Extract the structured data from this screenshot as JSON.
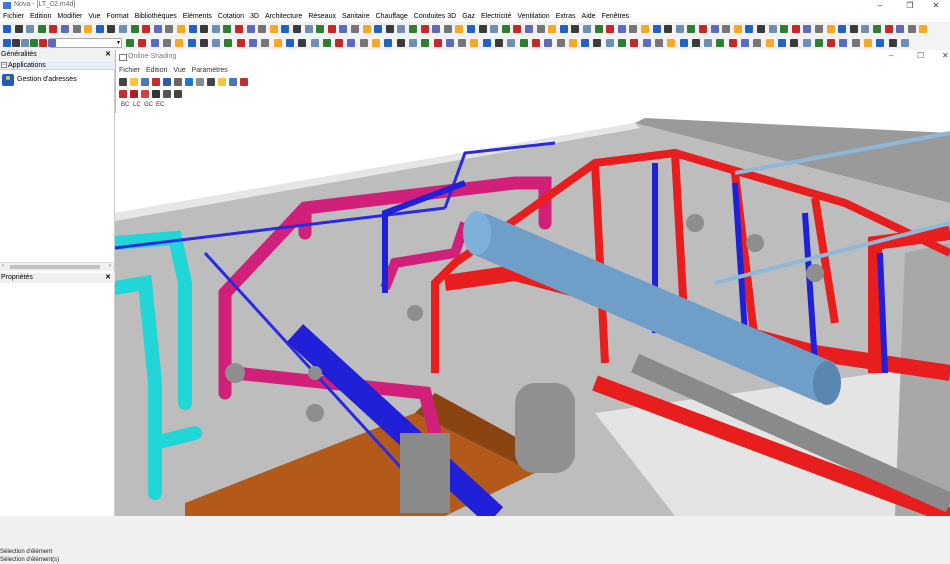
{
  "window": {
    "title": "Nova - [LT_02.m4d]"
  },
  "menu": [
    "Fichier",
    "Edition",
    "Modifier",
    "Vue",
    "Format",
    "Bibliothèques",
    "Eléments",
    "Cotation",
    "3D",
    "Architecture",
    "Réseaux",
    "Sanitaire",
    "Chauffage",
    "Conduites 3D",
    "Gaz",
    "Electricité",
    "Ventilation",
    "Extras",
    "Aide",
    "Fenêtres"
  ],
  "left_panel": {
    "header": "Généralités",
    "applications_label": "Applications",
    "app_item": "Gestion d'adresses",
    "properties_header": "Propriétés",
    "status_lines": [
      "Sélection d'élément",
      "Sélection d'élément(s)"
    ]
  },
  "child_window": {
    "title": "Online-Shading",
    "menu": [
      "Fichier",
      "Edition",
      "Vue",
      "Paramètres"
    ],
    "lod_buttons": [
      "BC",
      "LC",
      "GC",
      "EC"
    ]
  },
  "icons": {
    "close": "close-icon",
    "minimize": "minimize-icon",
    "restore": "restore-icon",
    "colors": {
      "hot_pipe": "#e81e1e",
      "cold_pipe": "#2a2ae0",
      "magenta_pipe": "#d0207a",
      "cyan_pipe": "#20d6d6",
      "tank": "#6f9ec9",
      "wall": "#c8c8c8",
      "floor": "#e0e0e0",
      "wood": "#b35a1a"
    }
  }
}
